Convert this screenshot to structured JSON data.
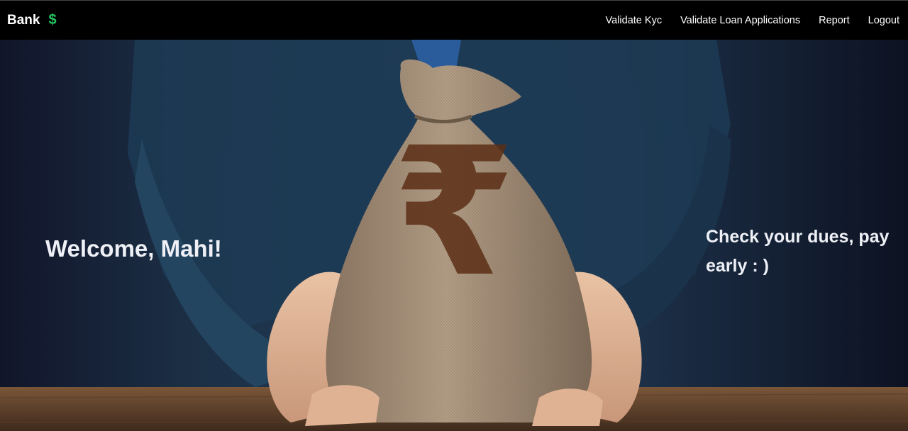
{
  "navbar": {
    "brand": "Bank",
    "brand_icon": "dollar-icon",
    "brand_icon_glyph": "$",
    "links": [
      {
        "label": "Validate Kyc"
      },
      {
        "label": "Validate Loan Applications"
      },
      {
        "label": "Report"
      },
      {
        "label": "Logout"
      }
    ]
  },
  "hero": {
    "welcome": "Welcome, Mahi!",
    "tagline": "Check your dues, pay early : )",
    "currency_glyph": "₹"
  },
  "colors": {
    "navbar_bg": "#000000",
    "brand_icon": "#22c55e",
    "hero_text": "#eef0f6"
  }
}
